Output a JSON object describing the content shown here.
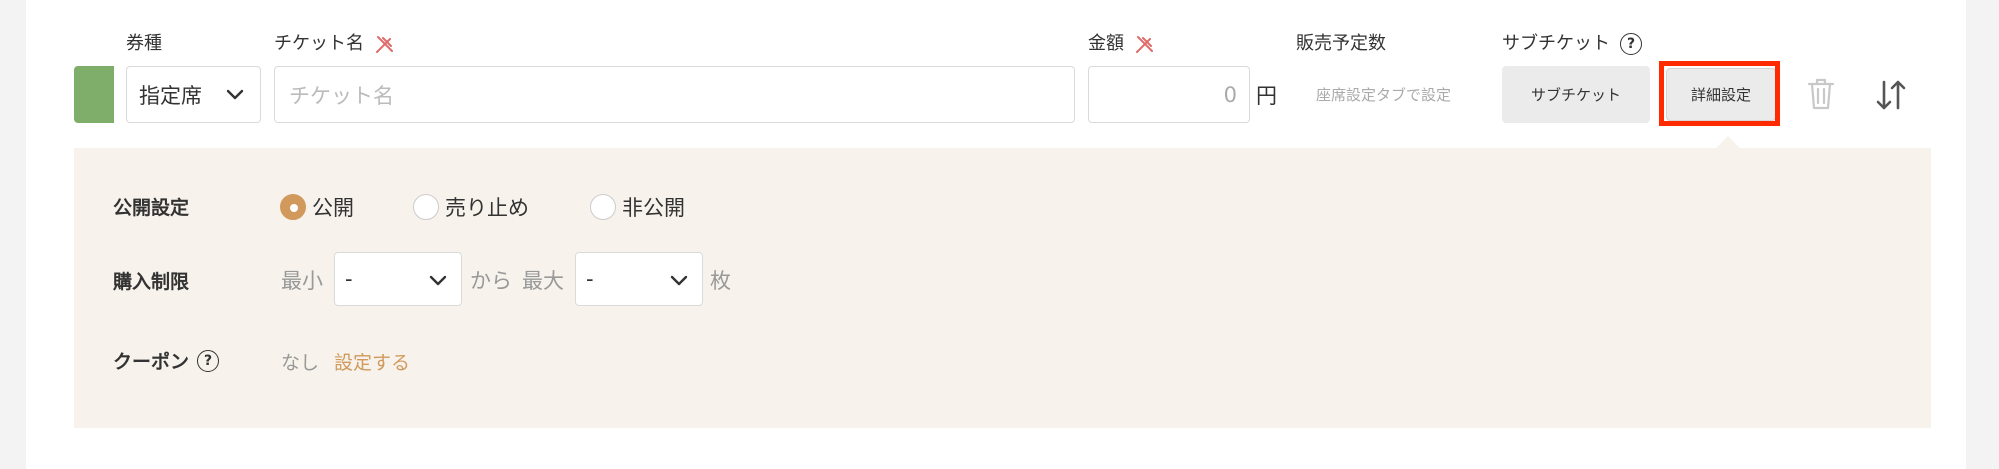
{
  "headers": {
    "type": "券種",
    "ticket_name": "チケット名",
    "price": "金額",
    "planned_sales": "販売予定数",
    "sub_ticket": "サブチケット"
  },
  "row": {
    "swatch_color": "#7fad6a",
    "type_value": "指定席",
    "name_placeholder": "チケット名",
    "price_value": "0",
    "currency": "円",
    "seat_note": "座席設定タブで設定",
    "sub_ticket_button": "サブチケット",
    "detail_button": "詳細設定"
  },
  "details": {
    "visibility_label": "公開設定",
    "visibility_options": [
      {
        "label": "公開",
        "selected": true
      },
      {
        "label": "売り止め",
        "selected": false
      },
      {
        "label": "非公開",
        "selected": false
      }
    ],
    "limit_label": "購入制限",
    "limit_min_label": "最小",
    "limit_min_value": "-",
    "limit_from": "から",
    "limit_max_label": "最大",
    "limit_max_value": "-",
    "limit_unit": "枚",
    "coupon_label": "クーポン",
    "coupon_value": "なし",
    "coupon_link": "設定する"
  },
  "help_glyph": "?",
  "colors": {
    "accent": "#d19a5c",
    "highlight": "#ff2a00",
    "required_pin": "#e06a6a",
    "panel_bg": "#f7f3ec"
  }
}
